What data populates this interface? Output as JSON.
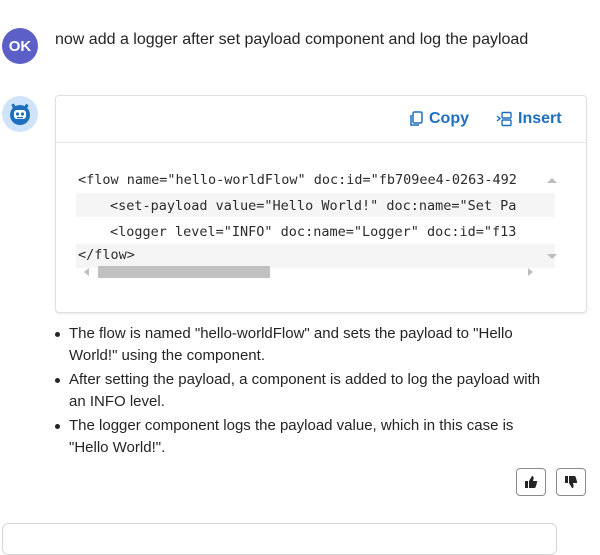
{
  "user": {
    "avatar_initials": "OK",
    "message": "now add a logger after set payload component and log the payload"
  },
  "bot": {
    "avatar_icon": "bot-face-icon",
    "toolbar": {
      "copy_label": "Copy",
      "insert_label": "Insert"
    },
    "code_lines": [
      "<flow name=\"hello-worldFlow\" doc:id=\"fb709ee4-0263-492",
      "<set-payload value=\"Hello World!\" doc:name=\"Set Pa",
      "<logger level=\"INFO\" doc:name=\"Logger\" doc:id=\"f13",
      "</flow>"
    ],
    "bullets": [
      "The flow is named \"hello-worldFlow\" and sets the payload to \"Hello World!\" using the component.",
      "After setting the payload, a component is added to log the payload with an INFO level.",
      "The logger component logs the payload value, which in this case is \"Hello World!\"."
    ]
  },
  "colors": {
    "accent": "#1f6fbf",
    "user_avatar_bg": "#5b5fc7",
    "bot_avatar_bg": "#cfe4fa"
  }
}
